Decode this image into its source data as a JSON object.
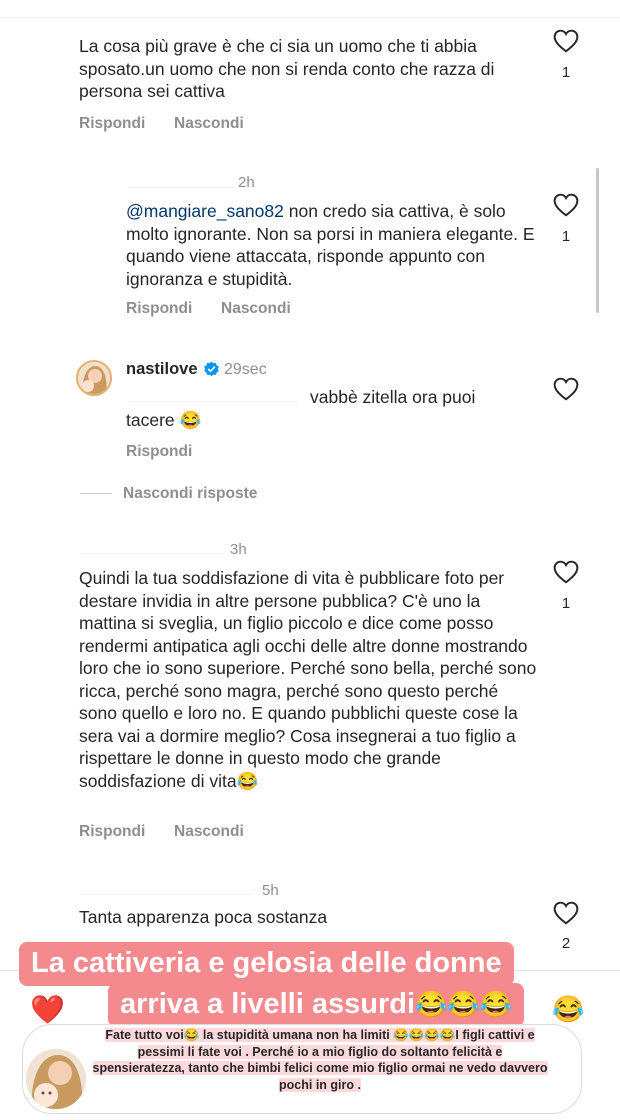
{
  "labels": {
    "reply": "Rispondi",
    "hide": "Nascondi",
    "hide_replies": "Nascondi risposte"
  },
  "comments": [
    {
      "time": "",
      "text": "La cosa più grave è che ci sia un uomo che ti abbia sposato.un uomo che non si renda conto che razza di persona sei cattiva",
      "likes": "1"
    },
    {
      "time": "2h",
      "mention": "@mangiare_sano82",
      "text": " non credo sia cattiva, è solo molto ignorante. Non sa porsi in maniera elegante. E quando viene attaccata, risponde appunto con ignoranza e stupidità.",
      "likes": "1"
    },
    {
      "username": "nastilove",
      "verified_icon": "verified-badge-icon",
      "time": "29sec",
      "text_line1": "vabbè zitella ora puoi",
      "text_line2": "tacere",
      "emoji": "😂"
    },
    {
      "time": "3h",
      "text": "Quindi la tua soddisfazione di vita è pubblicare foto per destare invidia in altre persone pubblica? C'è uno la mattina si sveglia, un figlio piccolo e dice come posso rendermi antipatica agli occhi delle altre donne mostrando loro che io sono superiore. Perché sono bella, perché sono ricca, perché sono magra, perché sono questo perché sono quello e loro no. E quando pubblichi queste cose la sera vai a dormire meglio? Cosa insegnerai a tuo figlio a rispettare le donne in questo modo che grande soddisfazione di vita",
      "emoji": "😂",
      "likes": "1"
    },
    {
      "time": "5h",
      "text": "Tanta apparenza poca sostanza",
      "likes": "2"
    }
  ],
  "caption": {
    "line1": "La cattiveria e gelosia delle donne",
    "line2": "arriva a livelli assurdi",
    "emojis": "😂😂😂"
  },
  "story_overlay": {
    "side_emoji": "😂",
    "heart_emoji": "❤️",
    "reply_text": "Fate tutto voi😂 la stupidità umana non ha limiti 😂😂😂😂I figli cattivi e pessimi li fate voi . Perché io a mio figlio do soltanto felicità e spensieratezza, tanto che bimbi felici come mio figlio ormai ne vedo davvero pochi in giro ."
  },
  "colors": {
    "text": "#262626",
    "meta": "#8e8e8e",
    "mention": "#00376b",
    "caption_bg": "#f58a8e",
    "verified": "#0095f6",
    "heart_red": "#e0102a"
  }
}
